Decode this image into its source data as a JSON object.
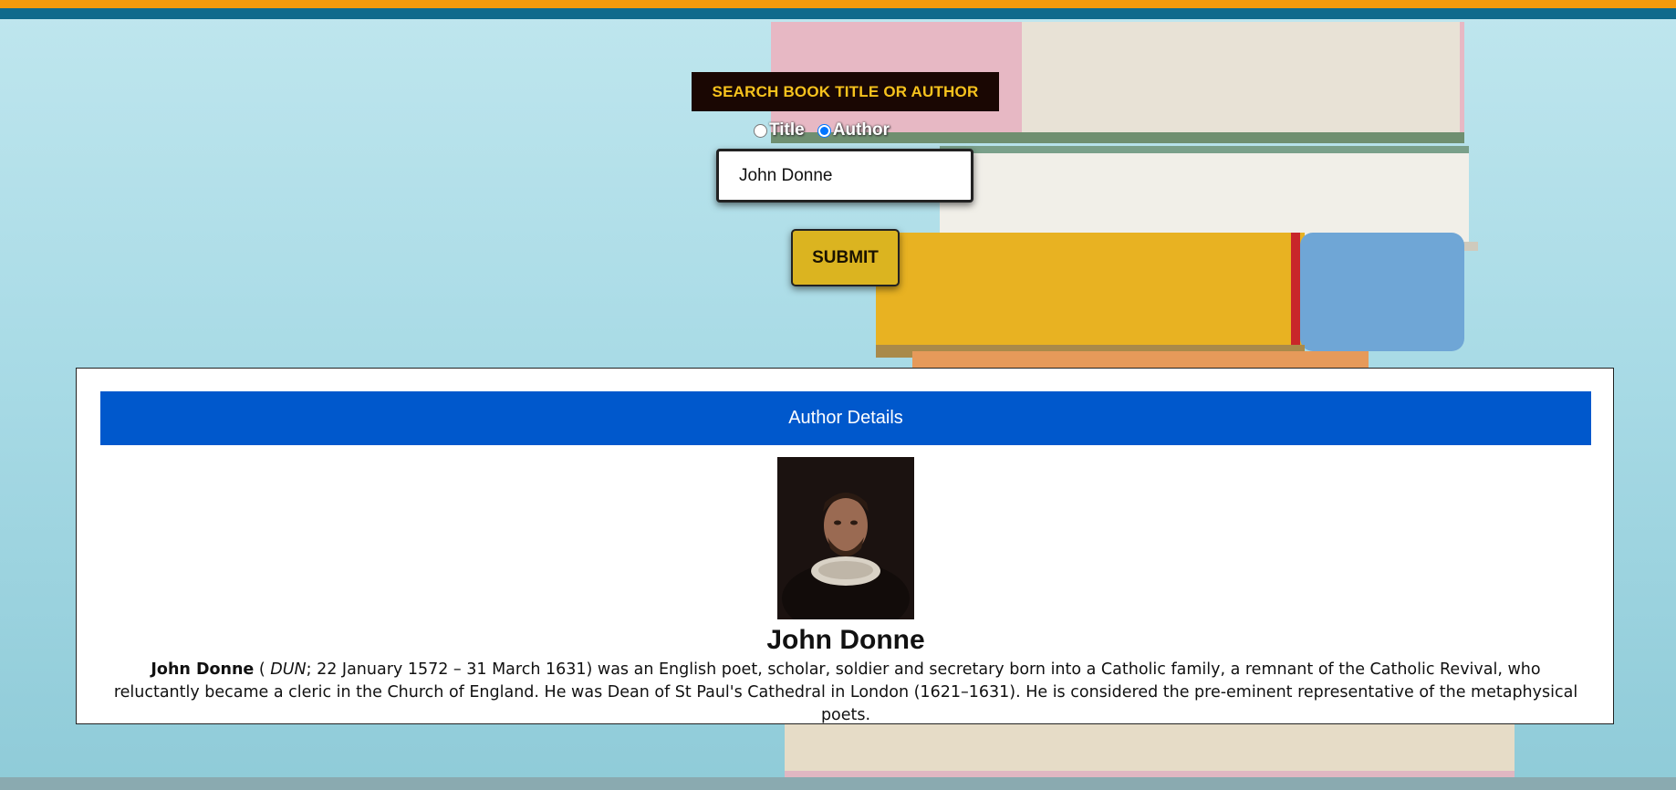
{
  "search": {
    "heading": "SEARCH BOOK TITLE OR AUTHOR",
    "options": [
      {
        "label": "Title",
        "checked": false
      },
      {
        "label": "Author",
        "checked": true
      }
    ],
    "query_value": "John Donne",
    "submit_label": "SUBMIT"
  },
  "author_card": {
    "header": "Author Details",
    "portrait_icon": "author-portrait",
    "name": "John Donne",
    "bio": {
      "lead_name": "John Donne",
      "open": " ( ",
      "pronunciation": "DUN",
      "text": "; 22 January 1572 – 31 March 1631) was an English poet, scholar, soldier and secretary born into a Catholic family, a remnant of the Catholic Revival, who reluctantly became a cleric in the Church of England. He was Dean of St Paul's Cathedral in London (1621–1631). He is considered the pre-eminent representative of the metaphysical poets."
    }
  },
  "colors": {
    "top_stripe": "#f39a0c",
    "top_bar": "#0f6a8c",
    "heading_bg": "#1a0703",
    "heading_text": "#f6c21d",
    "submit_bg": "#dbb420",
    "card_header_bg": "#0058cc"
  }
}
